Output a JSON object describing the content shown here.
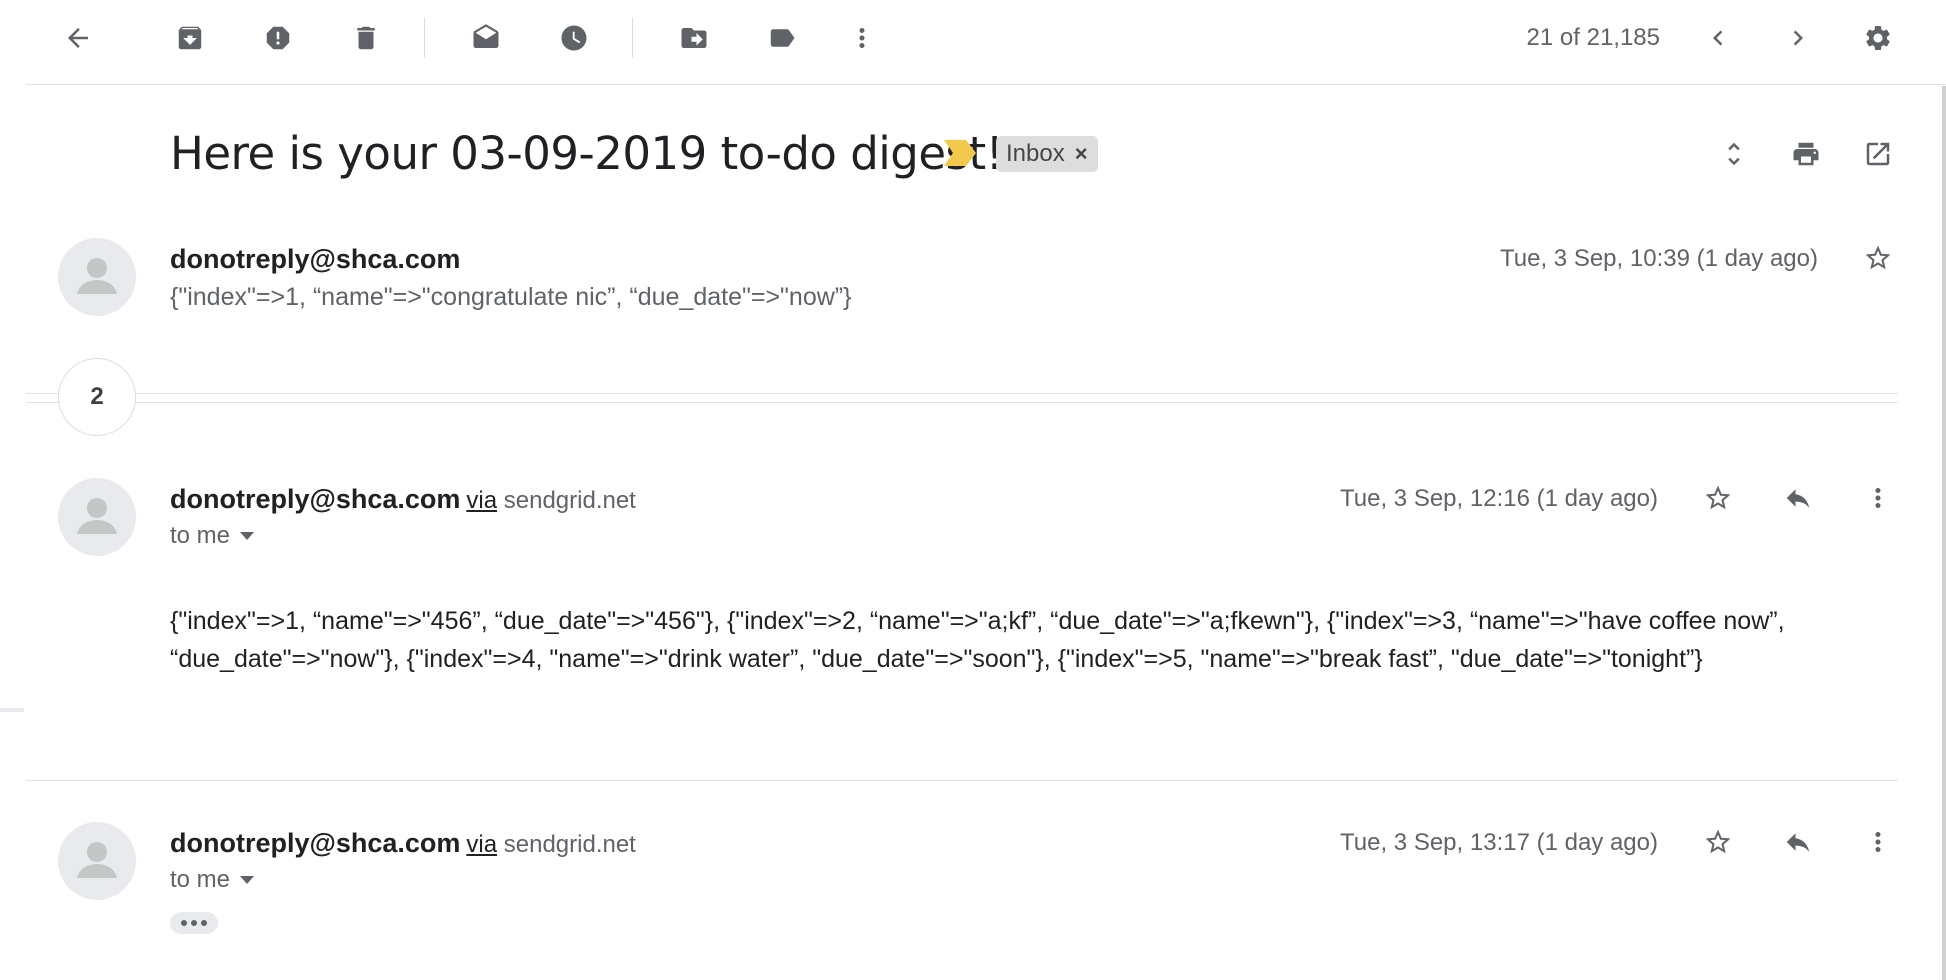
{
  "toolbar": {
    "back": "back-icon",
    "actions": [
      "archive-icon",
      "report-spam-icon",
      "delete-icon",
      "mark-unread-icon",
      "snooze-icon",
      "move-to-icon",
      "label-icon",
      "more-icon"
    ],
    "counter": "21 of 21,185",
    "settings": "gear-icon"
  },
  "thread": {
    "subject": "Here is your 03-09-2019 to-do digest!",
    "label": "Inbox",
    "label_remove": "×",
    "collapsed_count": "2"
  },
  "messages": [
    {
      "sender": "donotreply@shca.com",
      "date": "Tue, 3 Sep, 10:39 (1 day ago)",
      "snippet": "{\"index\"=>1, “name\"=>\"congratulate nic”, “due_date\"=>\"now”}"
    },
    {
      "sender": "donotreply@shca.com",
      "via_label": "via",
      "via_domain": "sendgrid.net",
      "recipient": "to me",
      "date": "Tue, 3 Sep, 12:16 (1 day ago)",
      "body": "{\"index\"=>1, “name\"=>\"456”, “due_date\"=>\"456\"}, {\"index\"=>2, “name\"=>\"a;kf”, “due_date\"=>\"a;fkewn\"}, {\"index\"=>3, “name\"=>\"have coffee now”, “due_date\"=>\"now\"}, {\"index\"=>4, \"name\"=>\"drink water”, \"due_date\"=>\"soon\"}, {\"index\"=>5, \"name\"=>\"break fast”, \"due_date\"=>\"tonight”}"
    },
    {
      "sender": "donotreply@shca.com",
      "via_label": "via",
      "via_domain": "sendgrid.net",
      "recipient": "to me",
      "date": "Tue, 3 Sep, 13:17 (1 day ago)"
    }
  ],
  "colors": {
    "icon": "#5f6368",
    "important_marker": "#f2c94c",
    "label_chip": "#dddddd"
  }
}
